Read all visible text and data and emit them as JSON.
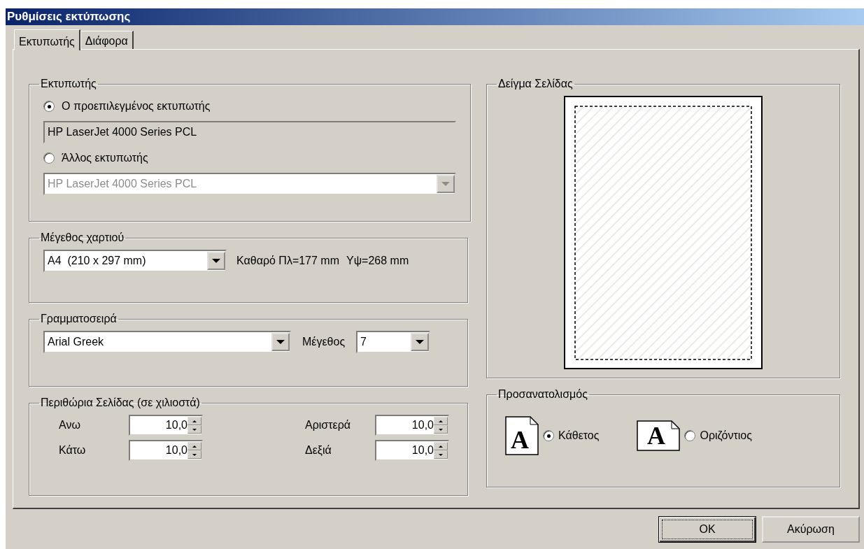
{
  "window": {
    "title": "Ρυθμίσεις εκτύπωσης"
  },
  "tabs": [
    {
      "label": "Εκτυπωτής",
      "selected": true
    },
    {
      "label": "Διάφορα",
      "selected": false
    }
  ],
  "printer_group": {
    "title": "Εκτυπωτής",
    "options": [
      {
        "label": "Ο προεπιλεγμένος εκτυπωτής",
        "selected": true,
        "field": {
          "kind": "readonly",
          "value": "HP LaserJet 4000 Series PCL",
          "disabled": false
        }
      },
      {
        "label": "Άλλος εκτυπωτής",
        "selected": false,
        "field": {
          "kind": "dropdown",
          "value": "HP LaserJet 4000 Series PCL",
          "disabled": true
        }
      }
    ]
  },
  "paper_group": {
    "title": "Μέγεθος χαρτιού",
    "size": {
      "value": "A4  (210 x 297 mm)"
    },
    "info": [
      "Καθαρό Πλ=177 mm",
      "Υψ=268 mm"
    ]
  },
  "font_group": {
    "title": "Γραμματοσειρά",
    "family": {
      "value": "Arial Greek"
    },
    "size_label": "Μέγεθος",
    "size": {
      "value": "7"
    }
  },
  "margins_group": {
    "title": "Περιθώρια Σελίδας (σε χιλιοστά)",
    "fields": [
      {
        "label": "Ανω",
        "value": "10,0"
      },
      {
        "label": "Αριστερά",
        "value": "10,0"
      },
      {
        "label": "Κάτω",
        "value": "10,0"
      },
      {
        "label": "Δεξιά",
        "value": "10,0"
      }
    ]
  },
  "preview_group": {
    "title": "Δείγμα Σελίδας"
  },
  "orientation_group": {
    "title": "Προσανατολισμός",
    "options": [
      {
        "kind": "portrait",
        "icon_letter": "A",
        "label": "Κάθετος",
        "selected": true
      },
      {
        "kind": "landscape",
        "icon_letter": "A",
        "label": "Οριζόντιος",
        "selected": false
      }
    ]
  },
  "buttons": [
    {
      "label": "OK",
      "default": true
    },
    {
      "label": "Ακύρωση",
      "default": false
    }
  ]
}
